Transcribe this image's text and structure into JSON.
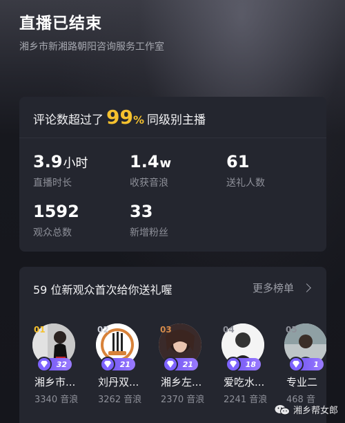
{
  "header": {
    "title": "直播已结束",
    "subtitle": "湘乡市新湘路朝阳咨询服务工作室"
  },
  "ranking": {
    "prefix": "评论数超过了",
    "percent": "99",
    "percent_sign": "%",
    "suffix": "同级别主播"
  },
  "stats": [
    {
      "value": "3.9",
      "unit": "小时",
      "label": "直播时长"
    },
    {
      "value": "1.4",
      "unit": "w",
      "label": "收获音浪"
    },
    {
      "value": "61",
      "unit": "",
      "label": "送礼人数"
    },
    {
      "value": "1592",
      "unit": "",
      "label": "观众总数"
    },
    {
      "value": "33",
      "unit": "",
      "label": "新增粉丝"
    }
  ],
  "gifters": {
    "title": "59 位新观众首次给你送礼喔",
    "more_label": "更多榜单",
    "items": [
      {
        "rank": "01",
        "level": "32",
        "name": "湘乡市...",
        "score": "3340 音浪",
        "rank_color": "#f5c12e"
      },
      {
        "rank": "02",
        "level": "21",
        "name": "刘丹双...",
        "score": "3262 音浪",
        "rank_color": "#c9ccd6"
      },
      {
        "rank": "03",
        "level": "21",
        "name": "湘乡左...",
        "score": "2370 音浪",
        "rank_color": "#d48a4a"
      },
      {
        "rank": "04",
        "level": "18",
        "name": "爱吃水...",
        "score": "2241 音浪",
        "rank_color": "#8e9099"
      },
      {
        "rank": "05",
        "level": "1",
        "name": "专业二",
        "score": "468 音",
        "rank_color": "#8e9099"
      }
    ]
  },
  "watermark": {
    "text": "湘乡帮女郎",
    "icon": "wechat-icon"
  }
}
